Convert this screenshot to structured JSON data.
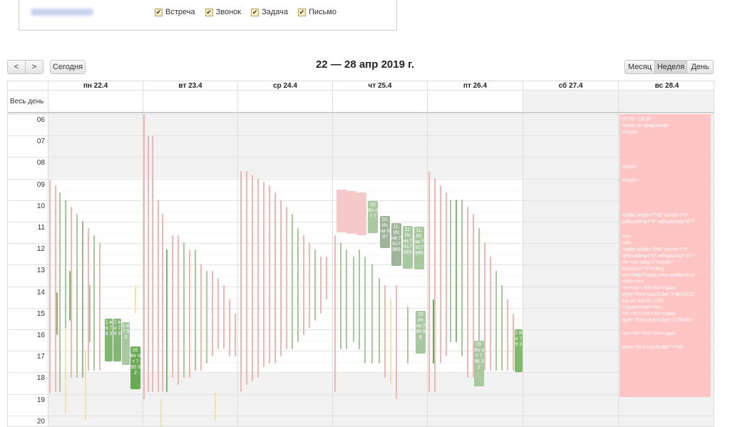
{
  "filters": [
    {
      "label": "Встреча",
      "checked": true
    },
    {
      "label": "Звонок",
      "checked": true
    },
    {
      "label": "Задача",
      "checked": true
    },
    {
      "label": "Письмо",
      "checked": true
    }
  ],
  "toolbar": {
    "prev_label": "<",
    "next_label": ">",
    "today_label": "Сегодня",
    "title": "22 — 28 апр 2019 г.",
    "views": {
      "month": "Месяц",
      "week": "Неделя",
      "day": "День"
    },
    "active_view": "week"
  },
  "allday_label": "Весь день",
  "days": [
    "пн 22.4",
    "вт 23.4",
    "ср 24.4",
    "чт 25.4",
    "пт 26.4",
    "сб 27.4",
    "вс 28.4"
  ],
  "hours": [
    "06",
    "07",
    "08",
    "09",
    "10",
    "11",
    "12",
    "13",
    "14",
    "15",
    "16",
    "17",
    "18",
    "19",
    "20"
  ],
  "big_event": {
    "time": "05:59 - 18:00",
    "lines": [
      "Заказ на продление",
      "создан",
      "<style>",
      "</style>",
      "<table width=\"700\" border=\"0\"",
      "cellpadding=\"0\" cellspacing=\"0\">",
      "<tr>",
      "<td>",
      "<table width=\"696\" border=\"0\"",
      "cellpadding=\"0\" cellspacing=\"0\">",
      "<tr><td valign=\"middle\"",
      "rowspan=\"5\"><img",
      "src=\"http://static.rrmx.ru/distributi",
      "</td></tr>",
      "<tr><td></td><td><span",
      "style=\"font-size:9.0pt;\"><b>ООО",
      "&quot;              &quot;, </b>",
      "</span></td></tr>",
      "<tr><td></td><td><span",
      "style=\"font-size:9.0pt;\">125040 г.",
      "<tr><td></td><td><span",
      "style=\"font-size:9.0pt;\">Тел."
    ]
  },
  "event_snippets": {
    "mon_a": "1 в о 7 9 3",
    "mon_b": "1 и 7 9 3",
    "mon_c": "16: Вх от 7 90 32",
    "thu_a": "10: Вх от 7",
    "thu_b": "10: Ис на 937",
    "thu_c": "11: Ис на 7 917 985",
    "thu_d": "15 Ис на 7 96 98",
    "fri_a": "16: Вх от 7 96 32",
    "fri_b": "1 В о 7 9 3"
  },
  "colors": {
    "pink": "#f5b5b5",
    "green_light": "#a8c8a0",
    "green_mid": "#7fb86e",
    "green_dark": "#6aaa55",
    "gray_green": "#9fb59a",
    "yellow": "#f0e2a8"
  }
}
